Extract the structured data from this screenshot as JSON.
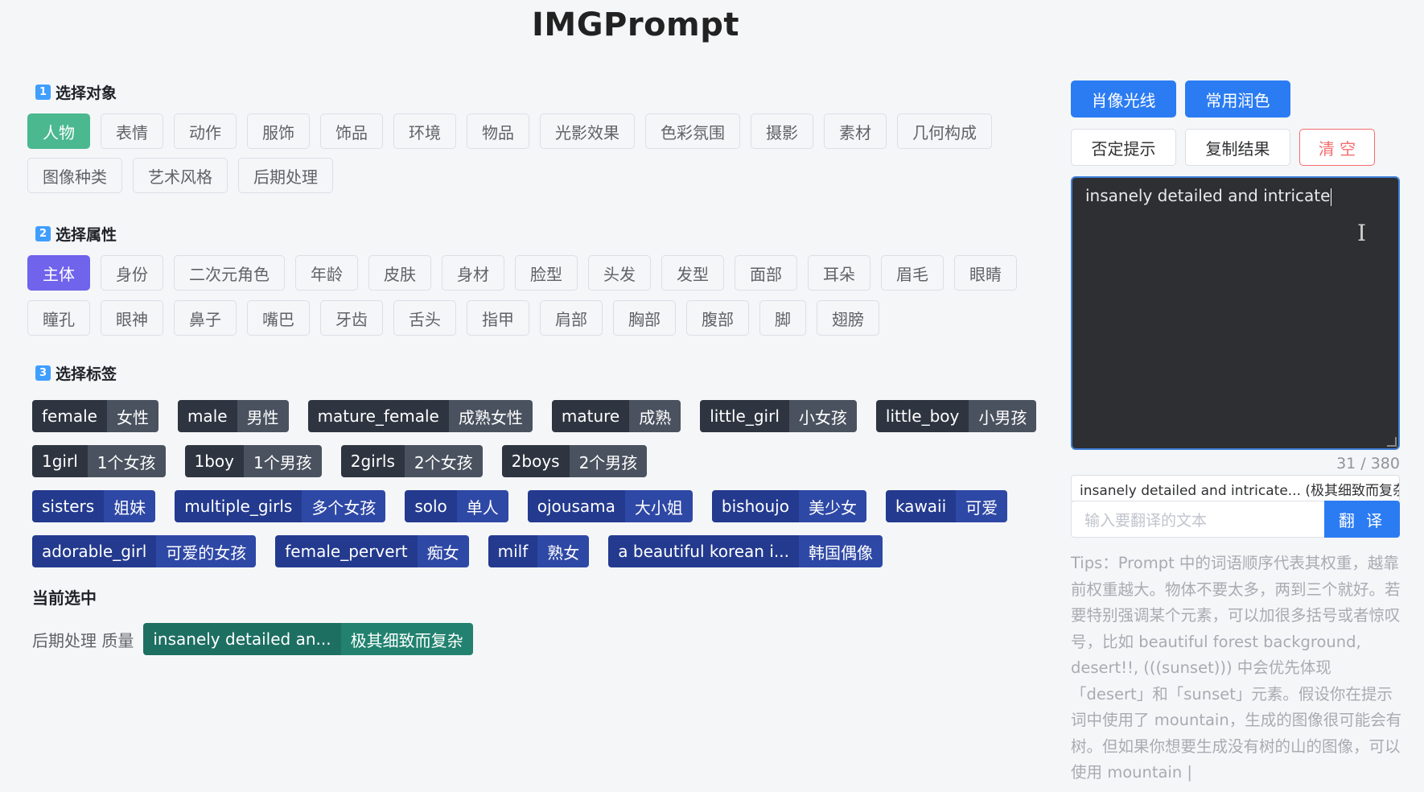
{
  "app": {
    "title": "IMGPrompt"
  },
  "section1": {
    "num": "1",
    "label": "选择对象",
    "row1": [
      "人物",
      "表情",
      "动作",
      "服饰",
      "饰品",
      "环境",
      "物品",
      "光影效果",
      "色彩氛围",
      "摄影",
      "素材",
      "几何构成"
    ],
    "row2": [
      "图像种类",
      "艺术风格",
      "后期处理"
    ],
    "active": "人物"
  },
  "section2": {
    "num": "2",
    "label": "选择属性",
    "row1": [
      "主体",
      "身份",
      "二次元角色",
      "年龄",
      "皮肤",
      "身材",
      "脸型",
      "头发",
      "发型",
      "面部",
      "耳朵",
      "眉毛",
      "眼睛"
    ],
    "row2": [
      "瞳孔",
      "眼神",
      "鼻子",
      "嘴巴",
      "牙齿",
      "舌头",
      "指甲",
      "肩部",
      "胸部",
      "腹部",
      "脚",
      "翅膀"
    ],
    "active": "主体"
  },
  "section3": {
    "num": "3",
    "label": "选择标签",
    "rows": [
      [
        {
          "en": "female",
          "zh": "女性",
          "style": "gray"
        },
        {
          "en": "male",
          "zh": "男性",
          "style": "gray"
        },
        {
          "en": "mature_female",
          "zh": "成熟女性",
          "style": "gray"
        },
        {
          "en": "mature",
          "zh": "成熟",
          "style": "gray"
        },
        {
          "en": "little_girl",
          "zh": "小女孩",
          "style": "gray"
        },
        {
          "en": "little_boy",
          "zh": "小男孩",
          "style": "gray"
        }
      ],
      [
        {
          "en": "1girl",
          "zh": "1个女孩",
          "style": "gray"
        },
        {
          "en": "1boy",
          "zh": "1个男孩",
          "style": "gray"
        },
        {
          "en": "2girls",
          "zh": "2个女孩",
          "style": "gray"
        },
        {
          "en": "2boys",
          "zh": "2个男孩",
          "style": "gray"
        }
      ],
      [
        {
          "en": "sisters",
          "zh": "姐妹",
          "style": "navy"
        },
        {
          "en": "multiple_girls",
          "zh": "多个女孩",
          "style": "navy"
        },
        {
          "en": "solo",
          "zh": "单人",
          "style": "navy"
        },
        {
          "en": "ojousama",
          "zh": "大小姐",
          "style": "navy"
        },
        {
          "en": "bishoujo",
          "zh": "美少女",
          "style": "navy"
        },
        {
          "en": "kawaii",
          "zh": "可爱",
          "style": "navy"
        }
      ],
      [
        {
          "en": "adorable_girl",
          "zh": "可爱的女孩",
          "style": "navy"
        },
        {
          "en": "female_pervert",
          "zh": "痴女",
          "style": "navy"
        },
        {
          "en": "milf",
          "zh": "熟女",
          "style": "navy"
        },
        {
          "en": "a beautiful korean i...",
          "zh": "韩国偶像",
          "style": "navy"
        }
      ]
    ]
  },
  "selected": {
    "heading": "当前选中",
    "label": "后期处理 质量",
    "tag": {
      "en": "insanely detailed an...",
      "zh": "极其细致而复杂"
    }
  },
  "right": {
    "buttons": {
      "portrait_light": "肖像光线",
      "common_color": "常用润色",
      "negative": "否定提示",
      "copy": "复制结果",
      "clear": "清 空"
    },
    "editor_text": "insanely detailed and intricate",
    "counter": "31 / 380",
    "result_line": "insanely detailed and intricate... (极其细致而复杂)",
    "translate_placeholder": "输入要翻译的文本",
    "translate_button": "翻 译",
    "tips": "Tips：Prompt 中的词语顺序代表其权重，越靠前权重越大。物体不要太多，两到三个就好。若要特别强调某个元素，可以加很多括号或者惊叹号，比如 beautiful forest background, desert!!, (((sunset))) 中会优先体现「desert」和「sunset」元素。假设你在提示词中使用了 mountain，生成的图像很可能会有树。但如果你想要生成没有树的山的图像，可以使用 mountain |"
  },
  "colors": {
    "primary": "#2b7cf2",
    "green": "#4bb890",
    "purple": "#7063ec",
    "danger": "#f56c6c"
  }
}
